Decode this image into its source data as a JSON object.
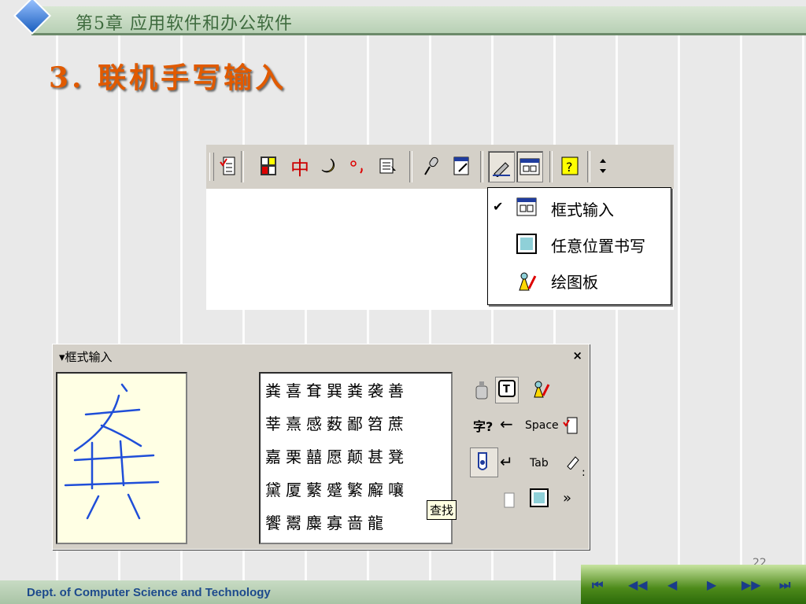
{
  "header": {
    "chapter": "第5章  应用软件和办公软件",
    "title": "3. 联机手写输入"
  },
  "toolbar": {
    "icons": [
      "checklist-icon",
      "softkey-icon",
      "zhong-icon",
      "half-moon-icon",
      "punct-icon",
      "help-book-icon",
      "mic-icon",
      "notepad-pen-icon",
      "handwriting-pen-icon",
      "frame-input-icon",
      "help-icon",
      "scroll-arrows-icon"
    ],
    "zhong_label": "中"
  },
  "menu": {
    "items": [
      {
        "label": "框式输入",
        "checked": "✔"
      },
      {
        "label": "任意位置书写"
      },
      {
        "label": "绘图板"
      }
    ]
  },
  "panel": {
    "title": "▾框式输入",
    "close": "×",
    "candidates": [
      "粪喜耷巽粪袭善",
      "莘熹感薮鄙笤蔗",
      "嘉栗囍愿颠甚凳",
      "黛厦蘩蹙繁廨嚷",
      "饗鬻麋寡啬龍"
    ],
    "controls": {
      "space": "Space",
      "tab": "Tab",
      "more": "»",
      "zi_q": "字?"
    },
    "tooltip": "查找"
  },
  "page_number": "22",
  "footer": {
    "dept": "Dept. of Computer Science and Technology"
  },
  "nav": {
    "buttons": [
      "⏮",
      "◀◀",
      "◀",
      "▶",
      "▶▶",
      "⏭"
    ]
  }
}
